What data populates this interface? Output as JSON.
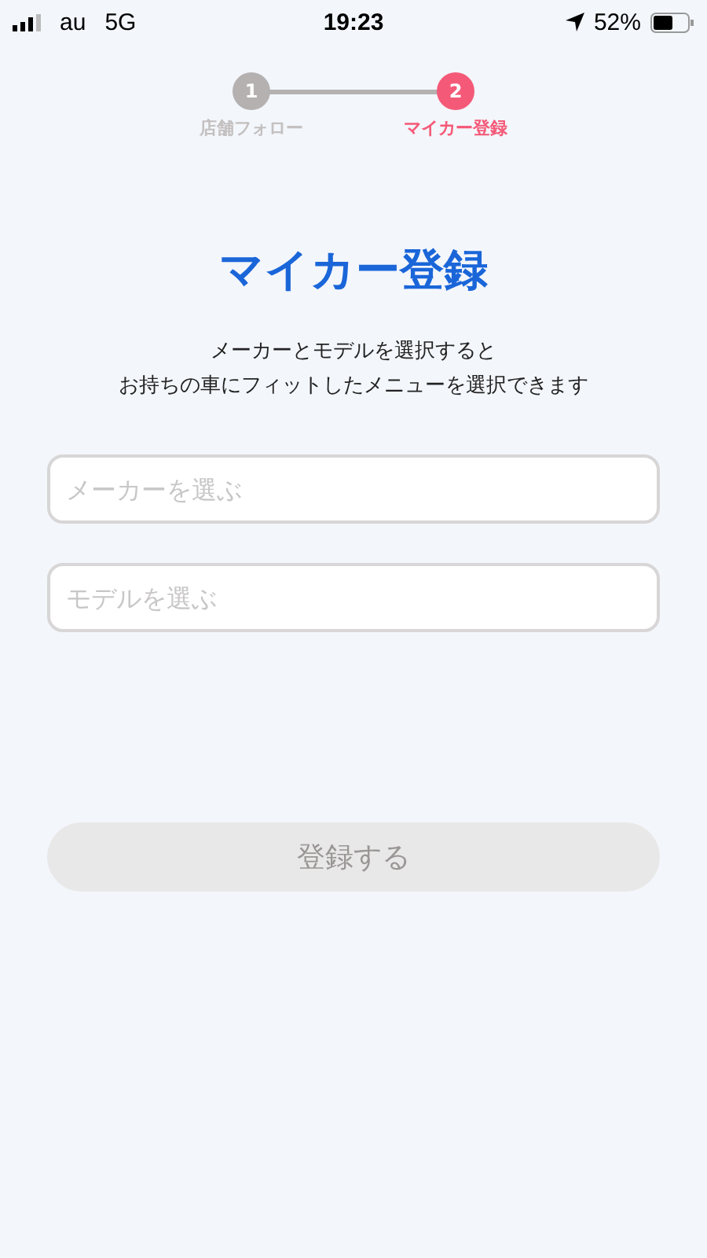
{
  "status_bar": {
    "carrier": "au",
    "network": "5G",
    "time": "19:23",
    "battery": "52%"
  },
  "steps": [
    {
      "number": "1",
      "label": "店舗フォロー",
      "selected": false
    },
    {
      "number": "2",
      "label": "マイカー登録",
      "selected": true
    }
  ],
  "title": "マイカー登録",
  "description": [
    "メーカーとモデルを選択すると",
    "お持ちの車にフィットしたメニューを選択できます"
  ],
  "fields": [
    {
      "placeholder": "メーカーを選ぶ"
    },
    {
      "placeholder": "モデルを選ぶ"
    }
  ],
  "submit": {
    "label": "登録する",
    "disabled": true
  }
}
